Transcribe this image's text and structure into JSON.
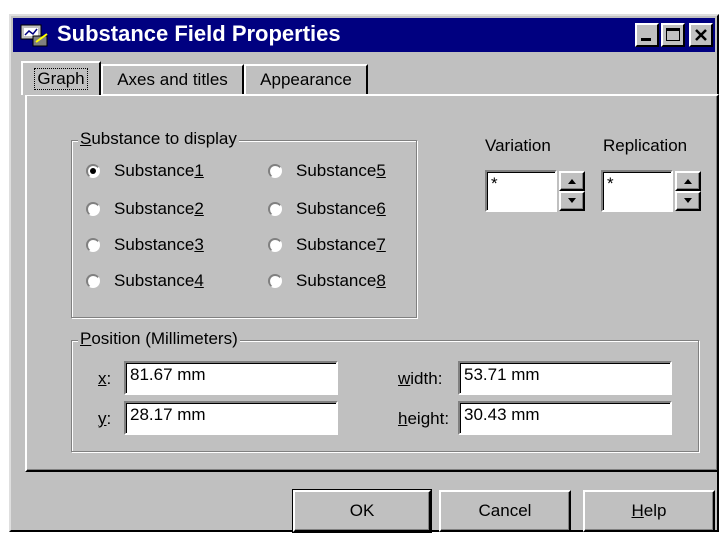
{
  "window": {
    "title": "Substance Field Properties"
  },
  "title_buttons": [
    "minimize",
    "maximize",
    "close"
  ],
  "tabs": [
    {
      "label": "Graph",
      "active": true
    },
    {
      "label": "Axes and titles",
      "active": false
    },
    {
      "label": "Appearance",
      "active": false
    }
  ],
  "substance_group": {
    "legend_prefix": "S",
    "legend_rest": "ubstance to display",
    "options": [
      {
        "pre": "Substance ",
        "key": "1",
        "selected": true
      },
      {
        "pre": "Substance ",
        "key": "5",
        "selected": false
      },
      {
        "pre": "Substance ",
        "key": "2",
        "selected": false
      },
      {
        "pre": "Substance ",
        "key": "6",
        "selected": false
      },
      {
        "pre": "Substance ",
        "key": "3",
        "selected": false
      },
      {
        "pre": "Substance ",
        "key": "7",
        "selected": false
      },
      {
        "pre": "Substance ",
        "key": "4",
        "selected": false
      },
      {
        "pre": "Substance ",
        "key": "8",
        "selected": false
      }
    ]
  },
  "variation": {
    "label": "Variation",
    "value": "*"
  },
  "replication": {
    "label": "Replication",
    "value": "*"
  },
  "position_group": {
    "legend_prefix": "P",
    "legend_rest": "osition (Millimeters)",
    "x": {
      "key": "x",
      "rest": ":",
      "value": "81.67 mm"
    },
    "y": {
      "key": "y",
      "rest": ":",
      "value": "28.17 mm"
    },
    "width": {
      "key": "w",
      "rest": "idth:",
      "value": "53.71 mm"
    },
    "height": {
      "key": "h",
      "rest": "eight:",
      "value": "30.43 mm"
    }
  },
  "buttons": {
    "ok": "OK",
    "cancel": "Cancel",
    "help_key": "H",
    "help_rest": "elp"
  }
}
